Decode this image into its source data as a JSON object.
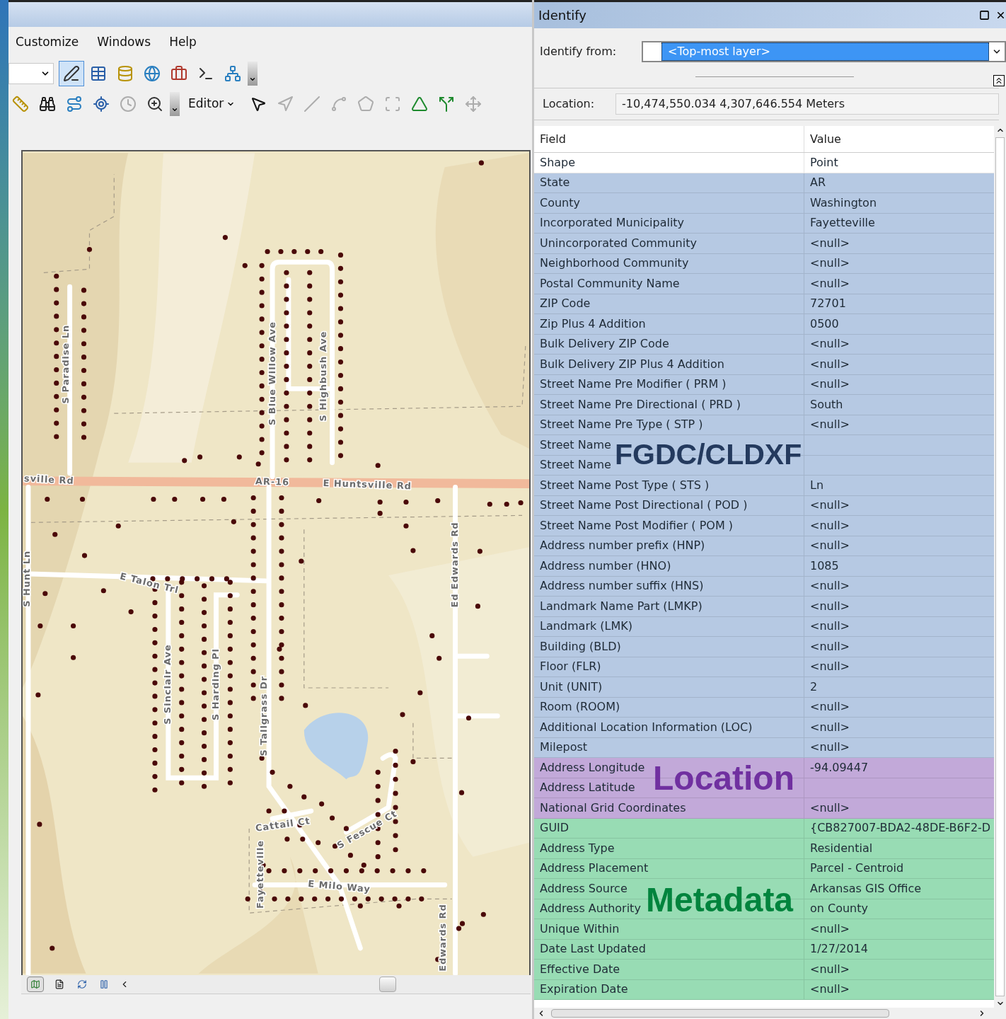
{
  "app_window": {
    "menu": [
      "Customize",
      "Windows",
      "Help"
    ],
    "toolbars": [
      {
        "items": [
          {
            "kind": "dropdown",
            "selected": false,
            "disabled": false
          },
          {
            "kind": "sketch",
            "selected": true,
            "disabled": false
          },
          {
            "kind": "table",
            "selected": false,
            "disabled": false
          },
          {
            "kind": "database",
            "selected": false,
            "disabled": false
          },
          {
            "kind": "globe",
            "selected": false,
            "disabled": false
          },
          {
            "kind": "toolbox",
            "selected": false,
            "disabled": false
          },
          {
            "kind": "terminal",
            "selected": false,
            "disabled": false
          },
          {
            "kind": "network",
            "selected": false,
            "disabled": false
          },
          {
            "kind": "overflow",
            "selected": false,
            "disabled": false
          }
        ]
      },
      {
        "items": [
          {
            "kind": "ruler",
            "disabled": false
          },
          {
            "kind": "binoculars",
            "disabled": false
          },
          {
            "kind": "route",
            "disabled": false
          },
          {
            "kind": "xy",
            "disabled": false
          },
          {
            "kind": "clock",
            "disabled": true
          },
          {
            "kind": "zoom",
            "disabled": false
          },
          {
            "kind": "overflow",
            "disabled": false
          },
          {
            "kind": "editor",
            "label": "Editor",
            "disabled": false
          },
          {
            "kind": "pointer",
            "disabled": false
          },
          {
            "kind": "annotation",
            "disabled": true
          },
          {
            "kind": "line",
            "disabled": true
          },
          {
            "kind": "curve",
            "disabled": true
          },
          {
            "kind": "polygon",
            "disabled": true
          },
          {
            "kind": "split",
            "disabled": true
          },
          {
            "kind": "topology",
            "disabled": false
          },
          {
            "kind": "topology_edit",
            "disabled": false
          },
          {
            "kind": "move",
            "disabled": true
          }
        ]
      }
    ],
    "map": {
      "street_labels": [
        "S Paradise Ln",
        "S Blue Willow Ave",
        "S Highbush Ave",
        "sville Rd",
        "AR-16",
        "E Huntsville Rd",
        "S Hunt Ln",
        "E Talon Trl",
        "S Sinclair Ave",
        "S Harding Pl",
        "S Tallgrass Dr",
        "Ed Edwards Rd",
        "Cattail Ct",
        "S Fescue Ct",
        "E Milo Way",
        "Fayetteville",
        "Edwards Rd"
      ]
    }
  },
  "identify": {
    "title": "Identify",
    "from_label": "Identify from:",
    "from_value": "<Top-most layer>",
    "location_label": "Location:",
    "location_value": "-10,474,550.034  4,307,646.554 Meters",
    "columns": [
      "Field",
      "Value"
    ],
    "rows": [
      {
        "field": "Shape",
        "value": "Point"
      },
      {
        "field": "State",
        "value": "AR",
        "color": "#b6c9e3"
      },
      {
        "field": "County",
        "value": "Washington",
        "color": "#b6c9e3"
      },
      {
        "field": "Incorporated Municipality",
        "value": "Fayetteville",
        "color": "#b6c9e3"
      },
      {
        "field": "Unincorporated Community",
        "value": "<null>",
        "color": "#b6c9e3"
      },
      {
        "field": "Neighborhood Community",
        "value": "<null>",
        "color": "#b6c9e3"
      },
      {
        "field": "Postal Community Name",
        "value": "<null>",
        "color": "#b6c9e3"
      },
      {
        "field": "ZIP Code",
        "value": "72701",
        "color": "#b6c9e3"
      },
      {
        "field": "Zip Plus 4 Addition",
        "value": "0500",
        "color": "#b6c9e3"
      },
      {
        "field": "Bulk Delivery ZIP Code",
        "value": "<null>",
        "color": "#b6c9e3"
      },
      {
        "field": "Bulk Delivery ZIP Plus 4 Addition",
        "value": "<null>",
        "color": "#b6c9e3"
      },
      {
        "field": "Street Name Pre Modifier ( PRM )",
        "value": "<null>",
        "color": "#b6c9e3"
      },
      {
        "field": "Street Name Pre Directional ( PRD )",
        "value": "South",
        "color": "#b6c9e3"
      },
      {
        "field": "Street Name Pre Type ( STP )",
        "value": "<null>",
        "color": "#b6c9e3"
      },
      {
        "field": "Street Name",
        "color": "#b6c9e3"
      },
      {
        "field": "Street Name",
        "color": "#b6c9e3"
      },
      {
        "field": "Street Name Post Type ( STS )",
        "value": "Ln",
        "color": "#b6c9e3"
      },
      {
        "field": "Street Name Post Directional ( POD )",
        "value": "<null>",
        "color": "#b6c9e3"
      },
      {
        "field": "Street Name Post Modifier ( POM )",
        "value": "<null>",
        "color": "#b6c9e3"
      },
      {
        "field": "Address number prefix (HNP)",
        "value": "<null>",
        "color": "#b6c9e3"
      },
      {
        "field": "Address number (HNO)",
        "value": "1085",
        "color": "#b6c9e3"
      },
      {
        "field": "Address number suffix (HNS)",
        "value": "<null>",
        "color": "#b6c9e3"
      },
      {
        "field": "Landmark Name Part (LMKP)",
        "value": "<null>",
        "color": "#b6c9e3"
      },
      {
        "field": "Landmark (LMK)",
        "value": "<null>",
        "color": "#b6c9e3"
      },
      {
        "field": "Building (BLD)",
        "value": "<null>",
        "color": "#b6c9e3"
      },
      {
        "field": "Floor (FLR)",
        "value": "<null>",
        "color": "#b6c9e3"
      },
      {
        "field": "Unit (UNIT)",
        "value": "2",
        "color": "#b6c9e3"
      },
      {
        "field": "Room (ROOM)",
        "value": "<null>",
        "color": "#b6c9e3"
      },
      {
        "field": "Additional Location Information (LOC)",
        "value": "<null>",
        "color": "#b6c9e3"
      },
      {
        "field": "Milepost",
        "value": "<null>",
        "color": "#b6c9e3"
      },
      {
        "field": "Address Longitude",
        "value": "-94.09447",
        "color": "#c2a9d9"
      },
      {
        "field": "Address Latitude",
        "color": "#c2a9d9"
      },
      {
        "field": "National Grid Coordinates",
        "value": "<null>",
        "color": "#c2a9d9"
      },
      {
        "field": "GUID",
        "value": "{CB827007-BDA2-48DE-B6F2-D",
        "color": "#98dcb4"
      },
      {
        "field": "Address Type",
        "value": "Residential",
        "color": "#98dcb4"
      },
      {
        "field": "Address Placement",
        "value": "Parcel  - Centroid",
        "color": "#98dcb4"
      },
      {
        "field": "Address Source",
        "value": "Arkansas GIS Office",
        "color": "#98dcb4"
      },
      {
        "field": "Address Authority",
        "value": "on County",
        "color": "#98dcb4"
      },
      {
        "field": "Unique Within",
        "value": "<null>",
        "color": "#98dcb4"
      },
      {
        "field": "Date Last Updated",
        "value": "1/27/2014",
        "color": "#98dcb4"
      },
      {
        "field": "Effective Date",
        "value": "<null>",
        "color": "#98dcb4"
      },
      {
        "field": "Expiration Date",
        "value": "<null>",
        "color": "#98dcb4"
      }
    ],
    "overlays": [
      {
        "text": "FGDC/CLDXF",
        "color": "#243a5e"
      },
      {
        "text": "Location",
        "color": "#7030a0"
      },
      {
        "text": "Metadata",
        "color": "#00843d"
      }
    ]
  }
}
